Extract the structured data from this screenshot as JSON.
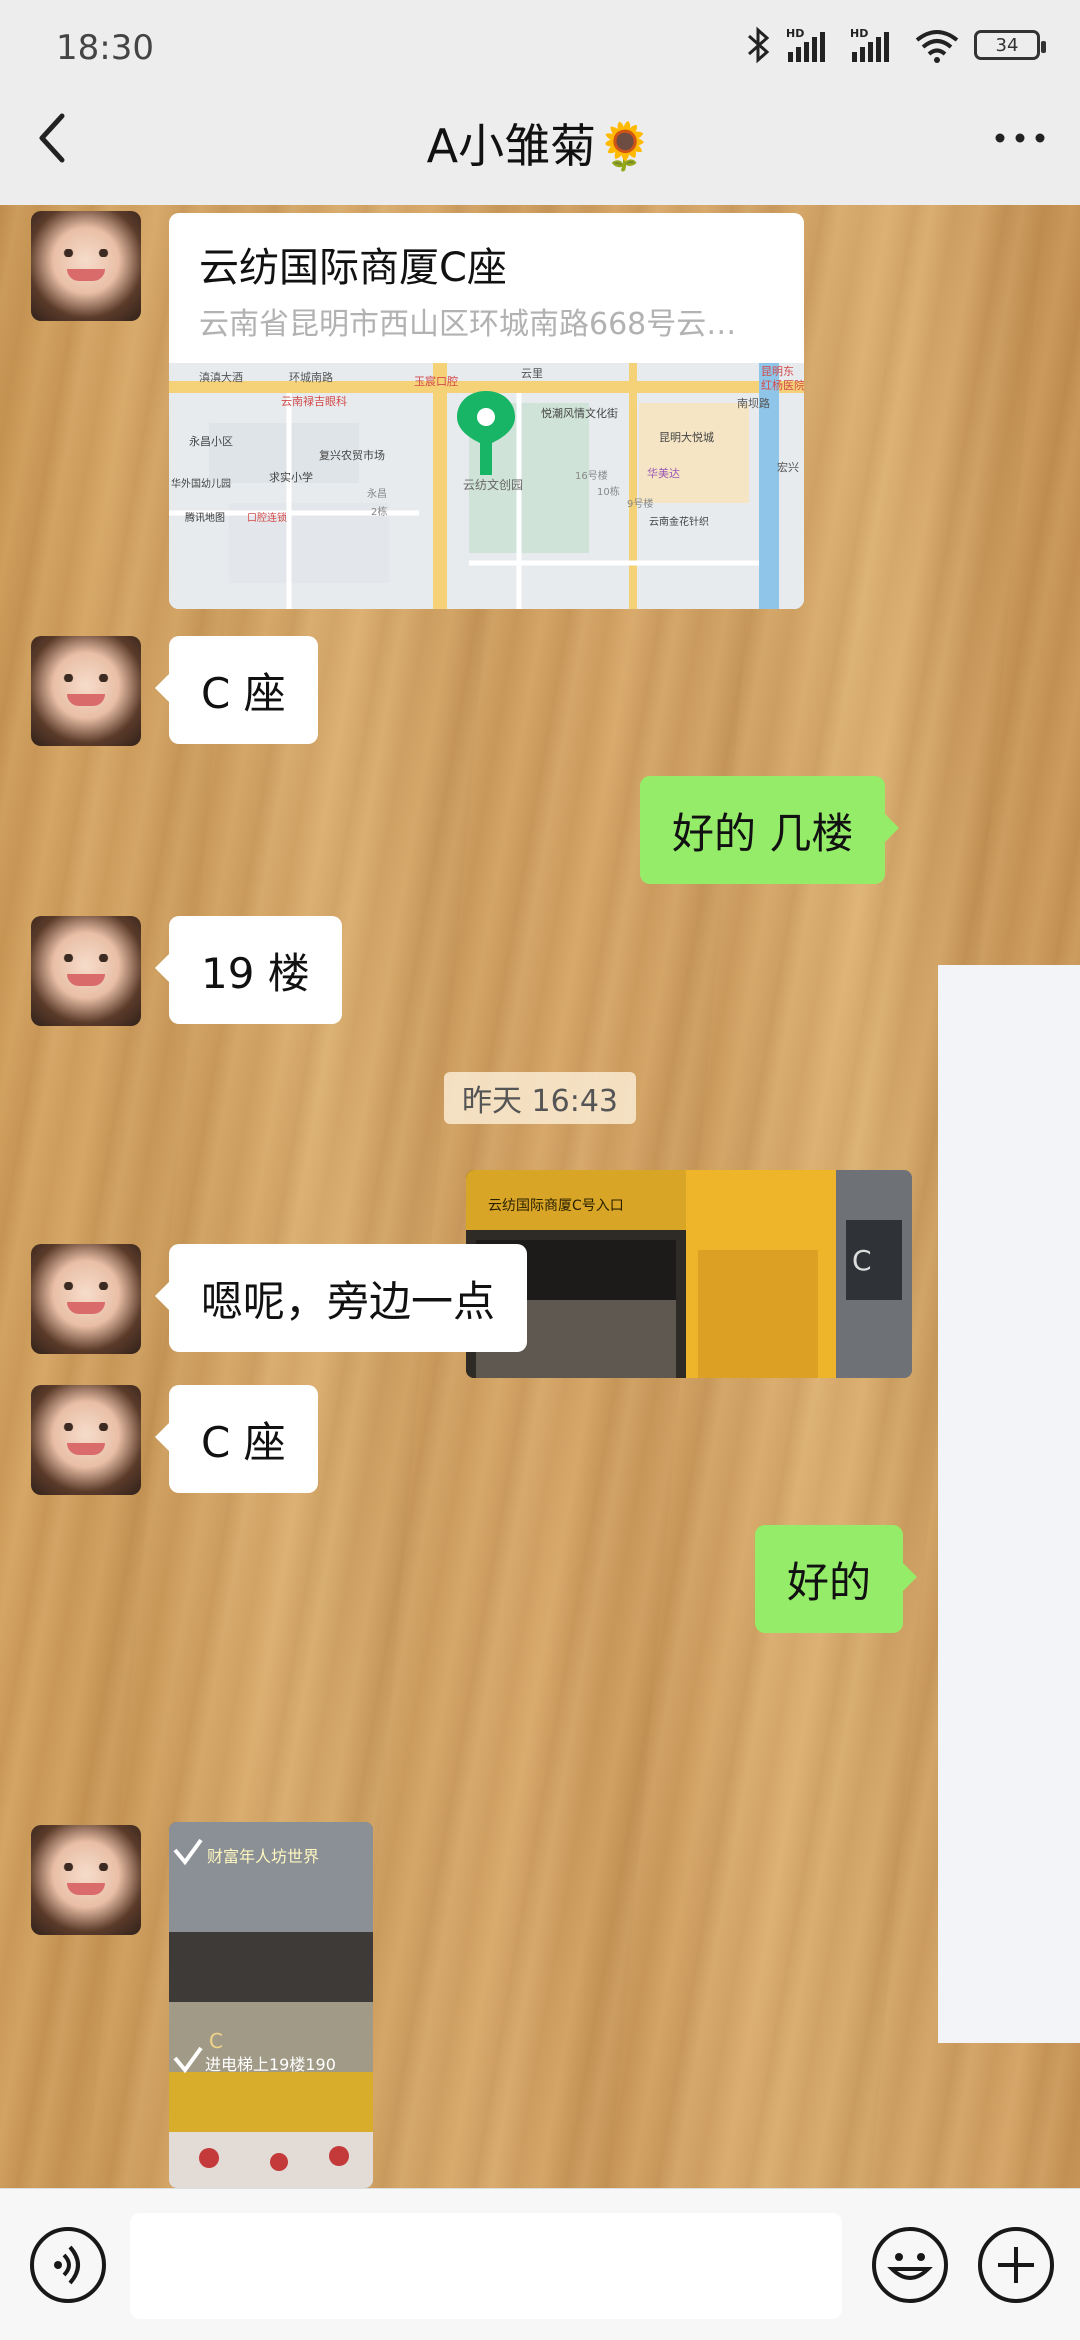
{
  "status_bar": {
    "time": "18:30",
    "battery": "34",
    "icons": [
      "bluetooth-icon",
      "hd-signal-icon",
      "hd-signal-icon",
      "wifi-icon",
      "battery-icon"
    ]
  },
  "header": {
    "title": "A小雏菊🌻",
    "back_icon": "chevron-left-icon",
    "more_icon": "more-dots-icon"
  },
  "messages": {
    "location": {
      "title": "云纺国际商厦C座",
      "address": "云南省昆明市西山区环城南路668号云…",
      "map_labels": [
        "滇滇大酒",
        "环城南路",
        "云南禄吉眼科",
        "玉宸口腔",
        "云里",
        "悦潮风情文化街",
        "昆明东",
        "红杨医院",
        "永昌小区",
        "复兴农贸市场",
        "昆明大悦城",
        "南坝路",
        "求实小学",
        "宏兴",
        "华美达",
        "16号楼",
        "10栋",
        "云纺文创园",
        "9号楼",
        "永昌",
        "2栋",
        "云南金花针织",
        "腾讯地图",
        "口腔连锁",
        "华外国幼儿园"
      ]
    },
    "m1": "C 座",
    "m2": "好的  几楼",
    "m3": "19 楼",
    "timestamp": "昨天  16:43",
    "m4": "嗯呢，旁边一点",
    "m5": "C 座",
    "m6": "好的",
    "photo2_text": [
      "财富年人坊世界",
      "C",
      "进电梯上19楼190"
    ]
  },
  "bottom": {
    "voice_icon": "voice-icon",
    "emoji_icon": "emoji-icon",
    "plus_icon": "plus-icon"
  }
}
